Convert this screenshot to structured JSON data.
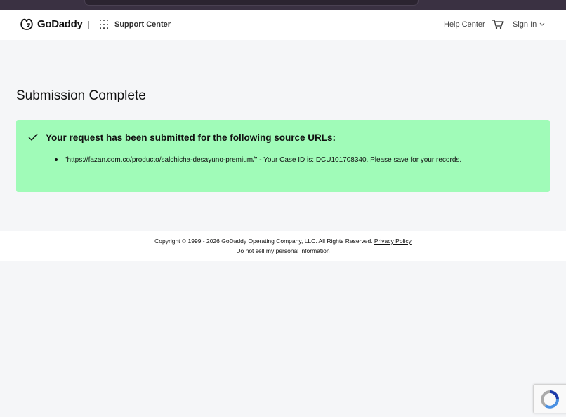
{
  "header": {
    "brand": "GoDaddy",
    "section": "Support Center",
    "help_center": "Help Center",
    "sign_in": "Sign In"
  },
  "main": {
    "title": "Submission Complete",
    "alert": {
      "heading": "Your request has been submitted for the following source URLs:",
      "items": [
        "\"https://fazan.com.co/producto/salchicha-desayuno-premium/\" - Your Case ID is: DCU101708340. Please save for your records."
      ]
    }
  },
  "footer": {
    "copyright": "Copyright © 1999 - 2026 GoDaddy Operating Company, LLC. All Rights Reserved.",
    "privacy_policy": "Privacy Policy",
    "do_not_sell": "Do not sell my personal information"
  },
  "colors": {
    "alert_bg": "#a0fbb8",
    "page_bg": "#f5f6f8",
    "header_bg": "#ffffff"
  },
  "icons": [
    "godaddy-logo-icon",
    "apps-grid-icon",
    "cart-icon",
    "chevron-down-icon",
    "check-icon",
    "recaptcha-icon"
  ]
}
